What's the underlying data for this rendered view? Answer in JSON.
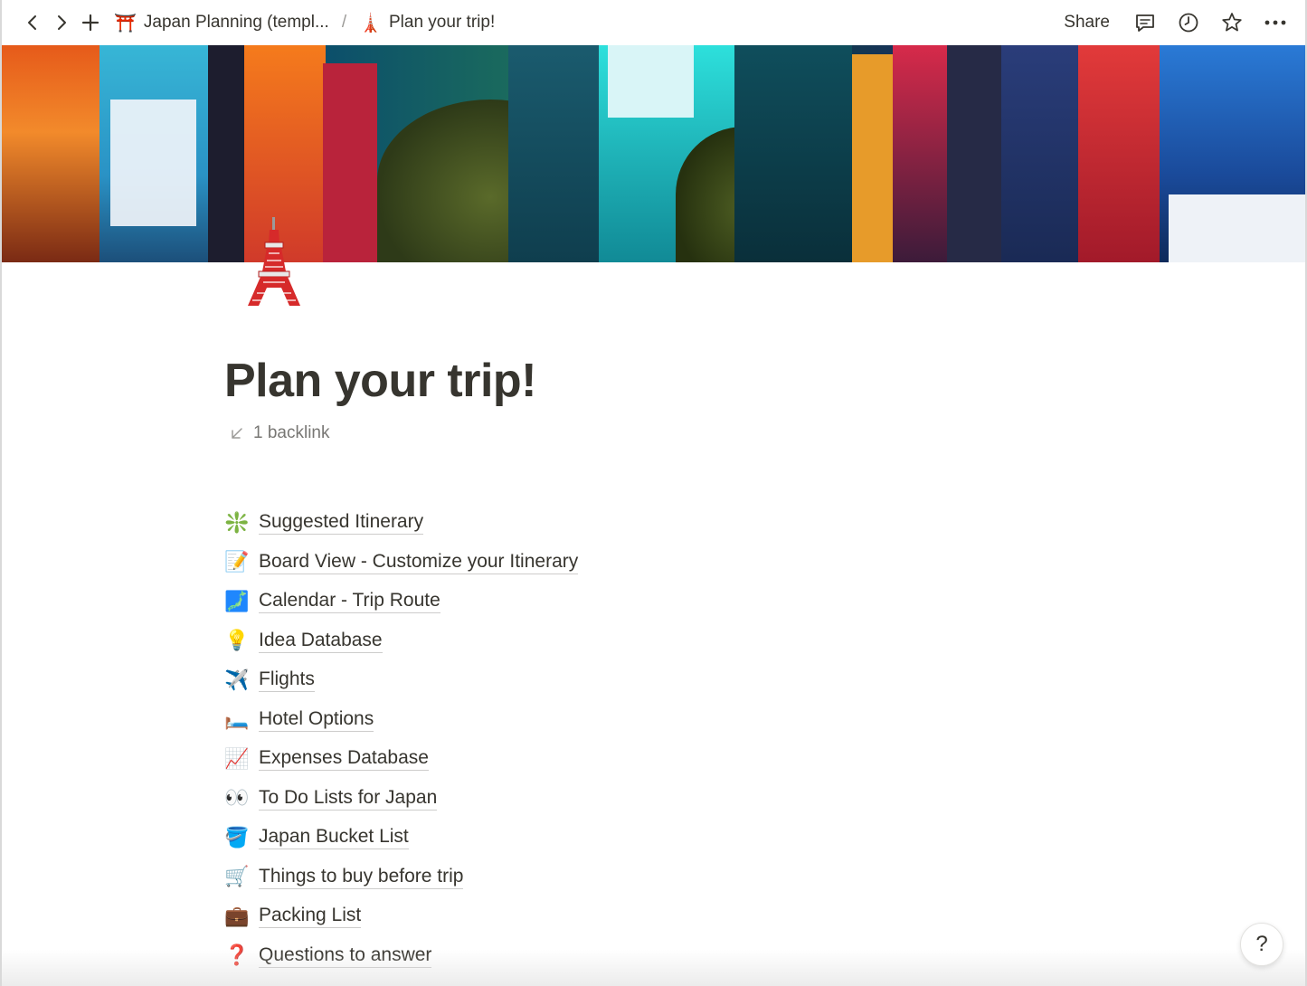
{
  "topbar": {
    "back_icon": "chevron-left-icon",
    "forward_icon": "chevron-right-icon",
    "new_icon": "plus-icon",
    "breadcrumb": [
      {
        "emoji": "⛩️",
        "label": "Japan Planning (templ..."
      },
      {
        "emoji": "🗼",
        "label": "Plan your trip!"
      }
    ],
    "separator": "/",
    "share_label": "Share"
  },
  "page": {
    "icon_emoji": "🗼",
    "title": "Plan your trip!",
    "backlink_label": "1 backlink"
  },
  "links": [
    {
      "emoji": "❇️",
      "label": "Suggested Itinerary"
    },
    {
      "emoji": "📝",
      "label": "Board View - Customize your Itinerary"
    },
    {
      "emoji": "🗾",
      "label": "Calendar - Trip Route"
    },
    {
      "emoji": "💡",
      "label": "Idea Database"
    },
    {
      "emoji": "✈️",
      "label": "Flights"
    },
    {
      "emoji": "🛏️",
      "label": "Hotel Options"
    },
    {
      "emoji": "📈",
      "label": "Expenses Database"
    },
    {
      "emoji": "👀",
      "label": "To Do Lists for Japan"
    },
    {
      "emoji": "🪣",
      "label": "Japan Bucket List"
    },
    {
      "emoji": "🛒",
      "label": "Things to buy before trip"
    },
    {
      "emoji": "💼",
      "label": "Packing List"
    },
    {
      "emoji": "❓",
      "label": "Questions to answer"
    }
  ],
  "help_label": "?",
  "colors": {
    "text": "#37352f",
    "muted": "#787774",
    "tower_red": "#d62a2a"
  }
}
